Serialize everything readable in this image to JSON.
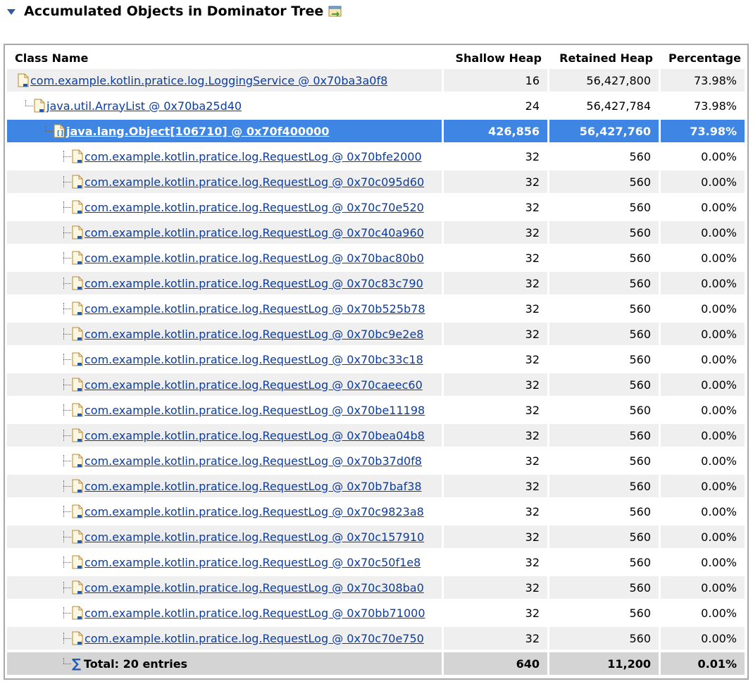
{
  "header": {
    "title": "Accumulated Objects in Dominator Tree",
    "expand_icon": "triangle-down-icon",
    "export_icon": "export-icon"
  },
  "columns": {
    "class_name": "Class Name",
    "shallow_heap": "Shallow Heap",
    "retained_heap": "Retained Heap",
    "percentage": "Percentage"
  },
  "rows": [
    {
      "name": "com.example.kotlin.pratice.log.LoggingService @ 0x70ba3a0f8",
      "shallow": "16",
      "retained": "56,427,800",
      "pct": "73.98%"
    },
    {
      "name": "java.util.ArrayList @ 0x70ba25d40",
      "shallow": "24",
      "retained": "56,427,784",
      "pct": "73.98%"
    },
    {
      "name": "java.lang.Object[106710] @ 0x70f400000",
      "shallow": "426,856",
      "retained": "56,427,760",
      "pct": "73.98%"
    }
  ],
  "children": [
    {
      "name": "com.example.kotlin.pratice.log.RequestLog @ 0x70bfe2000",
      "shallow": "32",
      "retained": "560",
      "pct": "0.00%"
    },
    {
      "name": "com.example.kotlin.pratice.log.RequestLog @ 0x70c095d60",
      "shallow": "32",
      "retained": "560",
      "pct": "0.00%"
    },
    {
      "name": "com.example.kotlin.pratice.log.RequestLog @ 0x70c70e520",
      "shallow": "32",
      "retained": "560",
      "pct": "0.00%"
    },
    {
      "name": "com.example.kotlin.pratice.log.RequestLog @ 0x70c40a960",
      "shallow": "32",
      "retained": "560",
      "pct": "0.00%"
    },
    {
      "name": "com.example.kotlin.pratice.log.RequestLog @ 0x70bac80b0",
      "shallow": "32",
      "retained": "560",
      "pct": "0.00%"
    },
    {
      "name": "com.example.kotlin.pratice.log.RequestLog @ 0x70c83c790",
      "shallow": "32",
      "retained": "560",
      "pct": "0.00%"
    },
    {
      "name": "com.example.kotlin.pratice.log.RequestLog @ 0x70b525b78",
      "shallow": "32",
      "retained": "560",
      "pct": "0.00%"
    },
    {
      "name": "com.example.kotlin.pratice.log.RequestLog @ 0x70bc9e2e8",
      "shallow": "32",
      "retained": "560",
      "pct": "0.00%"
    },
    {
      "name": "com.example.kotlin.pratice.log.RequestLog @ 0x70bc33c18",
      "shallow": "32",
      "retained": "560",
      "pct": "0.00%"
    },
    {
      "name": "com.example.kotlin.pratice.log.RequestLog @ 0x70caeec60",
      "shallow": "32",
      "retained": "560",
      "pct": "0.00%"
    },
    {
      "name": "com.example.kotlin.pratice.log.RequestLog @ 0x70be11198",
      "shallow": "32",
      "retained": "560",
      "pct": "0.00%"
    },
    {
      "name": "com.example.kotlin.pratice.log.RequestLog @ 0x70bea04b8",
      "shallow": "32",
      "retained": "560",
      "pct": "0.00%"
    },
    {
      "name": "com.example.kotlin.pratice.log.RequestLog @ 0x70b37d0f8",
      "shallow": "32",
      "retained": "560",
      "pct": "0.00%"
    },
    {
      "name": "com.example.kotlin.pratice.log.RequestLog @ 0x70b7baf38",
      "shallow": "32",
      "retained": "560",
      "pct": "0.00%"
    },
    {
      "name": "com.example.kotlin.pratice.log.RequestLog @ 0x70c9823a8",
      "shallow": "32",
      "retained": "560",
      "pct": "0.00%"
    },
    {
      "name": "com.example.kotlin.pratice.log.RequestLog @ 0x70c157910",
      "shallow": "32",
      "retained": "560",
      "pct": "0.00%"
    },
    {
      "name": "com.example.kotlin.pratice.log.RequestLog @ 0x70c50f1e8",
      "shallow": "32",
      "retained": "560",
      "pct": "0.00%"
    },
    {
      "name": "com.example.kotlin.pratice.log.RequestLog @ 0x70c308ba0",
      "shallow": "32",
      "retained": "560",
      "pct": "0.00%"
    },
    {
      "name": "com.example.kotlin.pratice.log.RequestLog @ 0x70bb71000",
      "shallow": "32",
      "retained": "560",
      "pct": "0.00%"
    },
    {
      "name": "com.example.kotlin.pratice.log.RequestLog @ 0x70c70e750",
      "shallow": "32",
      "retained": "560",
      "pct": "0.00%"
    }
  ],
  "total": {
    "label": "Total: 20 entries",
    "shallow": "640",
    "retained": "11,200",
    "pct": "0.01%",
    "icon": "sigma-icon"
  },
  "colors": {
    "selection": "#3f85e3",
    "link": "#0c3c9e",
    "stripe": "#efefef",
    "total_bg": "#d4d4d4"
  }
}
